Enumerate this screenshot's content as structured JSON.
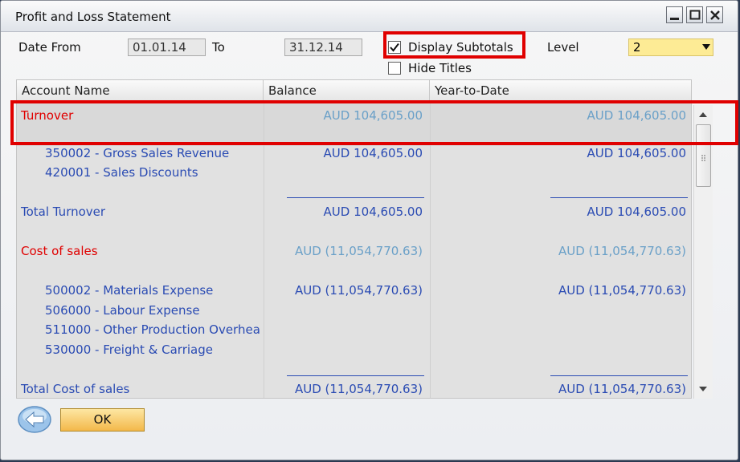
{
  "window": {
    "title": "Profit and Loss Statement",
    "controls": [
      "minimize-icon",
      "maximize-icon",
      "close-icon"
    ]
  },
  "filters": {
    "date_from_label": "Date From",
    "date_from_value": "01.01.14",
    "to_label": "To",
    "to_value": "31.12.14",
    "display_subtotals_label": "Display Subtotals",
    "display_subtotals_checked": true,
    "hide_titles_label": "Hide Titles",
    "hide_titles_checked": false,
    "level_label": "Level",
    "level_value": "2"
  },
  "table": {
    "columns": [
      "Account Name",
      "Balance",
      "Year-to-Date"
    ],
    "rows": [
      {
        "name": "Turnover",
        "balance": "AUD  104,605.00",
        "ytd": "AUD  104,605.00",
        "kind": "title"
      },
      {
        "name": "350002 - Gross Sales Revenue",
        "balance": "AUD  104,605.00",
        "ytd": "AUD  104,605.00",
        "kind": "account"
      },
      {
        "name": "420001 - Sales Discounts",
        "balance": "",
        "ytd": "",
        "kind": "account"
      },
      {
        "name": "Total Turnover",
        "balance": "AUD  104,605.00",
        "ytd": "AUD  104,605.00",
        "kind": "total"
      },
      {
        "name": "Cost of sales",
        "balance": "AUD (11,054,770.63)",
        "ytd": "AUD (11,054,770.63)",
        "kind": "title"
      },
      {
        "name": "500002 - Materials Expense",
        "balance": "AUD (11,054,770.63)",
        "ytd": "AUD (11,054,770.63)",
        "kind": "account"
      },
      {
        "name": "506000 - Labour Expense",
        "balance": "",
        "ytd": "",
        "kind": "account"
      },
      {
        "name": "511000 - Other Production Overhea",
        "balance": "",
        "ytd": "",
        "kind": "account"
      },
      {
        "name": "530000 - Freight & Carriage",
        "balance": "",
        "ytd": "",
        "kind": "account"
      },
      {
        "name": "Total Cost of sales",
        "balance": "AUD (11,054,770.63)",
        "ytd": "AUD (11,054,770.63)",
        "kind": "total"
      }
    ]
  },
  "footer": {
    "back_icon": "back-arrow-icon",
    "ok_label": "OK"
  },
  "colors": {
    "highlight_box": "#e00000",
    "title_row_text": "#e00000",
    "account_text": "#2a4bb3",
    "muted_amount": "#6aa0c8",
    "level_field_bg": "#fdeb95",
    "ok_button_bg": "#f3b84a"
  }
}
